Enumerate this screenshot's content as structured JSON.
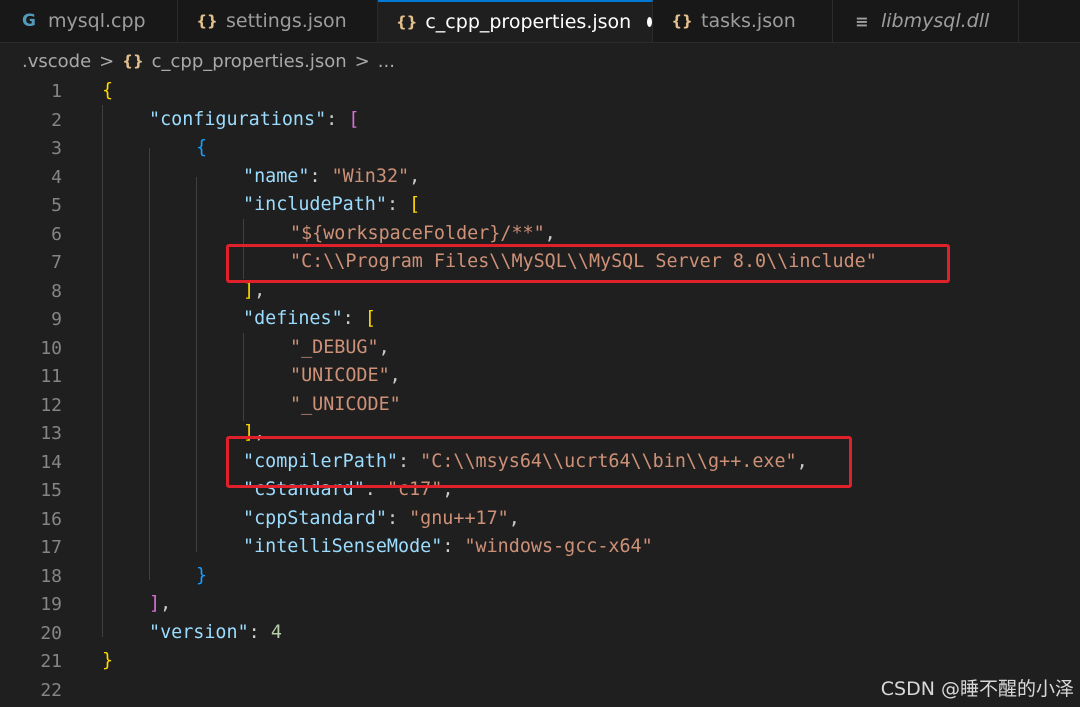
{
  "tabs": [
    {
      "label": "mysql.cpp",
      "icon": "cpp-file-icon",
      "glyph": "G"
    },
    {
      "label": "settings.json",
      "icon": "json-braces-icon",
      "glyph": "{}"
    },
    {
      "label": "c_cpp_properties.json",
      "icon": "json-braces-icon",
      "glyph": "{}",
      "active": true,
      "dirty": true
    },
    {
      "label": "tasks.json",
      "icon": "json-braces-icon",
      "glyph": "{}"
    },
    {
      "label": "libmysql.dll",
      "icon": "binary-file-icon",
      "glyph": "≡"
    }
  ],
  "breadcrumb": {
    "folder": ".vscode",
    "separator": ">",
    "file_icon": "{}",
    "file": "c_cpp_properties.json",
    "ellipsis": "..."
  },
  "line_numbers": [
    "1",
    "2",
    "3",
    "4",
    "5",
    "6",
    "7",
    "8",
    "9",
    "10",
    "11",
    "12",
    "13",
    "14",
    "15",
    "16",
    "17",
    "18",
    "19",
    "20",
    "21",
    "22"
  ],
  "code": {
    "l1_open": "{",
    "l2_key": "\"configurations\"",
    "l2_colon": ": ",
    "l2_open": "[",
    "l3_open": "{",
    "l4_key": "\"name\"",
    "l4_val": "\"Win32\"",
    "l5_key": "\"includePath\"",
    "l5_open": "[",
    "l6_val": "\"${workspaceFolder}/**\"",
    "l7_val": "\"C:\\\\Program Files\\\\MySQL\\\\MySQL Server 8.0\\\\include\"",
    "l8_close": "]",
    "l9_key": "\"defines\"",
    "l9_open": "[",
    "l10_val": "\"_DEBUG\"",
    "l11_val": "\"UNICODE\"",
    "l12_val": "\"_UNICODE\"",
    "l13_close": "]",
    "l14_key": "\"compilerPath\"",
    "l14_val": "\"C:\\\\msys64\\\\ucrt64\\\\bin\\\\g++.exe\"",
    "l15_key": "\"cStandard\"",
    "l15_val": "\"c17\"",
    "l16_key": "\"cppStandard\"",
    "l16_val": "\"gnu++17\"",
    "l17_key": "\"intelliSenseMode\"",
    "l17_val": "\"windows-gcc-x64\"",
    "l18_close": "}",
    "l19_close": "]",
    "l20_key": "\"version\"",
    "l20_val": "4",
    "l21_close": "}",
    "comma": ",",
    "colon": ": "
  },
  "watermark": "CSDN @睡不醒的小泽",
  "colors": {
    "background": "#1f1f1f",
    "key": "#9cdcfe",
    "string": "#ce9178",
    "number": "#b5cea8",
    "bracket_gold": "#ffd700",
    "bracket_purple": "#da70d6",
    "bracket_blue": "#179fff",
    "highlight_box": "#e0202a",
    "active_tab_accent": "#0078d4"
  }
}
